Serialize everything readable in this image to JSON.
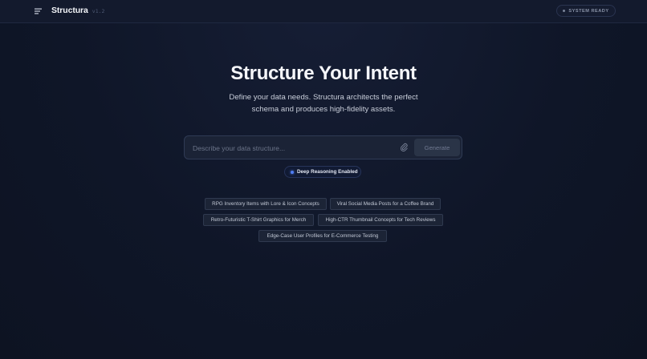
{
  "header": {
    "brand_name": "Structura",
    "version": "v1.2",
    "status": "SYSTEM READY",
    "menu_icon": "menu-icon"
  },
  "hero": {
    "title": "Structure Your Intent",
    "subtitle_line1": "Define your data needs. Structura architects the perfect",
    "subtitle_line2": "schema and produces high-fidelity assets."
  },
  "prompt": {
    "placeholder": "Describe your data structure...",
    "value": "",
    "attach_icon": "paperclip-icon",
    "generate_label": "Generate"
  },
  "reasoning": {
    "label": "Deep Reasoning Enabled",
    "enabled": true
  },
  "suggestions": [
    "RPG Inventory Items with Lore & Icon Concepts",
    "Viral Social Media Posts for a Coffee Brand",
    "Retro-Futuristic T-Shirt Graphics for Merch",
    "High-CTR Thumbnail Concepts for Tech Reviews",
    "Edge-Case User Profiles for E-Commerce Testing"
  ],
  "colors": {
    "background": "#0f1628",
    "accent": "#4f7df2",
    "chip_bg": "#1c2436"
  }
}
